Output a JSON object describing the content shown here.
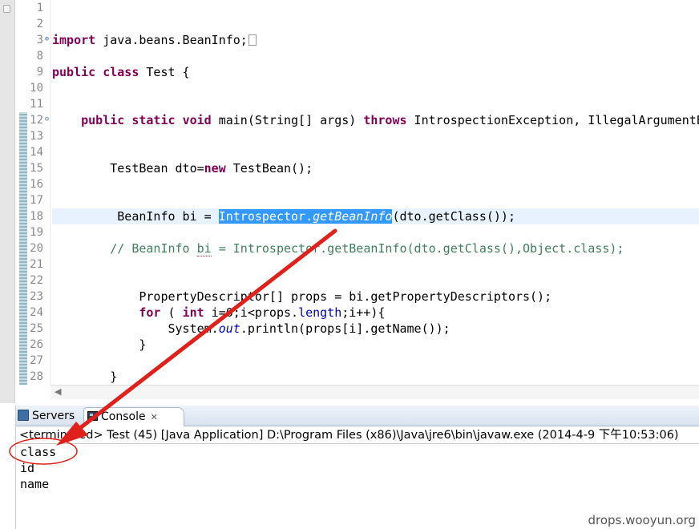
{
  "editor": {
    "lines": [
      {
        "n": "1",
        "text": ""
      },
      {
        "n": "2",
        "text": ""
      },
      {
        "n": "3",
        "text": "import java.beans.BeanInfo;"
      },
      {
        "n": "8",
        "text": ""
      },
      {
        "n": "9",
        "text": "public class Test {"
      },
      {
        "n": "10",
        "text": ""
      },
      {
        "n": "11",
        "text": ""
      },
      {
        "n": "12",
        "text": "    public static void main(String[] args) throws IntrospectionException, IllegalArgumentE"
      },
      {
        "n": "13",
        "text": ""
      },
      {
        "n": "14",
        "text": ""
      },
      {
        "n": "15",
        "text": "        TestBean dto=new TestBean();"
      },
      {
        "n": "16",
        "text": ""
      },
      {
        "n": "17",
        "text": ""
      },
      {
        "n": "18",
        "text": "         BeanInfo bi = Introspector.getBeanInfo(dto.getClass());"
      },
      {
        "n": "19",
        "text": ""
      },
      {
        "n": "20",
        "text": "        // BeanInfo bi = Introspector.getBeanInfo(dto.getClass(),Object.class);"
      },
      {
        "n": "21",
        "text": ""
      },
      {
        "n": "22",
        "text": ""
      },
      {
        "n": "23",
        "text": "            PropertyDescriptor[] props = bi.getPropertyDescriptors();"
      },
      {
        "n": "24",
        "text": "            for ( int i=0;i<props.length;i++){"
      },
      {
        "n": "25",
        "text": "                System.out.println(props[i].getName());"
      },
      {
        "n": "26",
        "text": "            }"
      },
      {
        "n": "27",
        "text": ""
      },
      {
        "n": "28",
        "text": "        }"
      }
    ],
    "selected_text": "Introspector.getBeanInfo"
  },
  "console": {
    "tabs": [
      {
        "label": "Servers",
        "icon": "servers-icon"
      },
      {
        "label": "Console",
        "icon": "console-icon",
        "active": true
      }
    ],
    "close_glyph": "✕",
    "status": "<terminated> Test (45) [Java Application] D:\\Program Files (x86)\\Java\\jre6\\bin\\javaw.exe (2014-4-9 下午10:53:06)",
    "output": [
      "class",
      "id",
      "name"
    ]
  },
  "watermark": "drops.wooyun.org",
  "annotation": {
    "color": "#e0201a"
  }
}
